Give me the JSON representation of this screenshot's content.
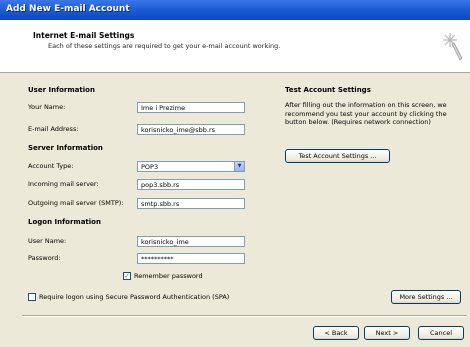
{
  "window": {
    "title": "Add New E-mail Account"
  },
  "header": {
    "title": "Internet E-mail Settings",
    "subtitle": "Each of these settings are required to get your e-mail account working."
  },
  "user_info": {
    "heading": "User Information",
    "name_label": "Your Name:",
    "name_value": "Ime i Prezime",
    "email_label": "E-mail Address:",
    "email_value": "korisnicko_ime@sbb.rs"
  },
  "server_info": {
    "heading": "Server Information",
    "account_type_label": "Account Type:",
    "account_type_value": "POP3",
    "incoming_label": "Incoming mail server:",
    "incoming_value": "pop3.sbb.rs",
    "outgoing_label": "Outgoing mail server (SMTP):",
    "outgoing_value": "smtp.sbb.rs"
  },
  "logon_info": {
    "heading": "Logon Information",
    "username_label": "User Name:",
    "username_value": "korisnicko_ime",
    "password_label": "Password:",
    "password_value": "**********",
    "remember_label": "Remember password",
    "remember_checked": true,
    "spa_label": "Require logon using Secure Password Authentication (SPA)",
    "spa_checked": false
  },
  "test_settings": {
    "heading": "Test Account Settings",
    "description": "After filling out the information on this screen, we recommend you test your account by clicking the button below. (Requires network connection)",
    "button_label": "Test Account Settings ..."
  },
  "buttons": {
    "more_settings": "More Settings ...",
    "back": "< Back",
    "next": "Next >",
    "cancel": "Cancel"
  }
}
